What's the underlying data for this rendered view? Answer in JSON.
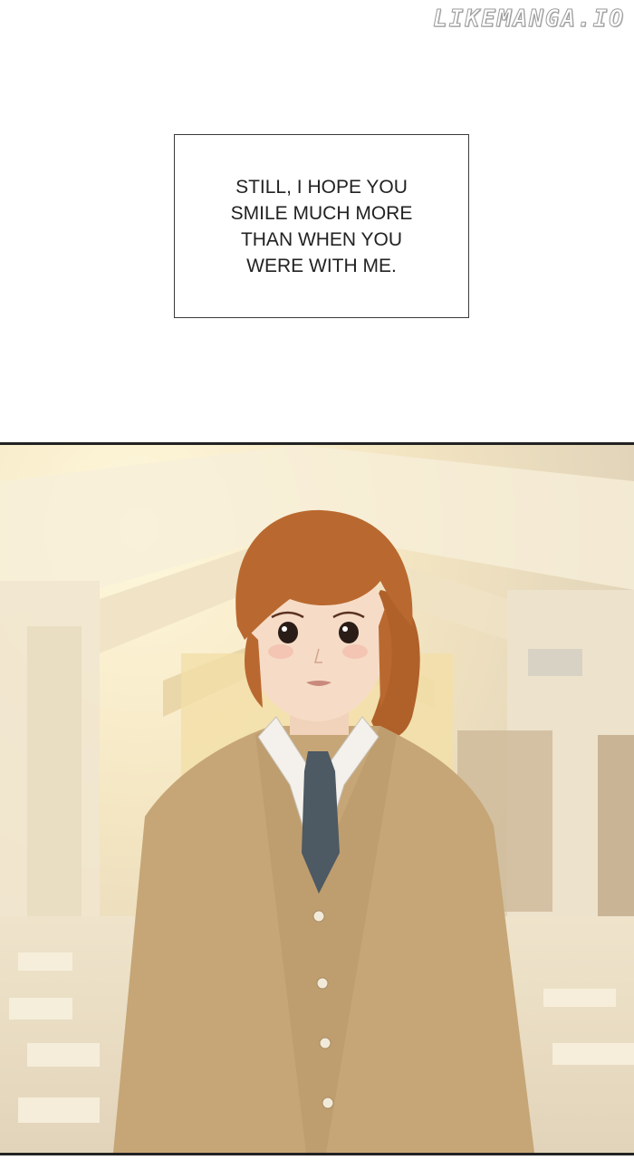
{
  "watermark": "LIKEMANGA.IO",
  "caption": {
    "lines": "STILL, I HOPE YOU\nSMILE MUCH MORE\nTHAN WHEN YOU\nWERE WITH ME."
  },
  "panel": {
    "scene": "school-hallway",
    "colors": {
      "light": "#fbf1d6",
      "wall": "#e8dcc4",
      "hair": "#b8682f",
      "cardigan": "#c9a979",
      "shirt": "#f5f2ee",
      "tie": "#4e5a64",
      "skin": "#f5dcc6"
    }
  }
}
